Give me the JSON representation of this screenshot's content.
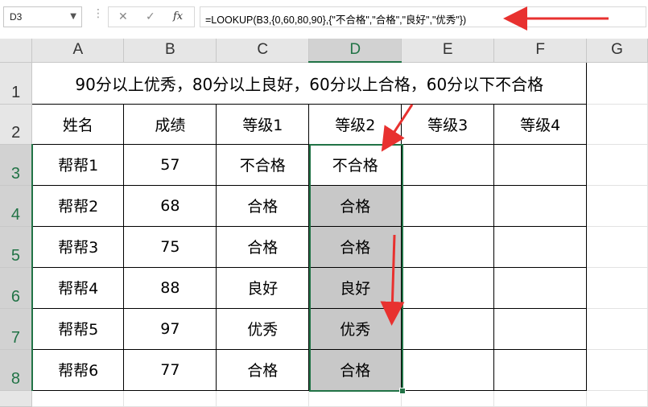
{
  "name_box": "D3",
  "formula": "=LOOKUP(B3,{0,60,80,90},{\"不合格\",\"合格\",\"良好\",\"优秀\"})",
  "formula_buttons": {
    "cancel": "✕",
    "enter": "✓",
    "fx": "fx"
  },
  "columns": [
    "A",
    "B",
    "C",
    "D",
    "E",
    "F",
    "G"
  ],
  "rows": [
    "1",
    "2",
    "3",
    "4",
    "5",
    "6",
    "7",
    "8"
  ],
  "title": "90分以上优秀，80分以上良好，60分以上合格，60分以下不合格",
  "headers": [
    "姓名",
    "成绩",
    "等级1",
    "等级2",
    "等级3",
    "等级4"
  ],
  "data_rows": [
    [
      "帮帮1",
      "57",
      "不合格",
      "不合格",
      "",
      ""
    ],
    [
      "帮帮2",
      "68",
      "合格",
      "合格",
      "",
      ""
    ],
    [
      "帮帮3",
      "75",
      "合格",
      "合格",
      "",
      ""
    ],
    [
      "帮帮4",
      "88",
      "良好",
      "良好",
      "",
      ""
    ],
    [
      "帮帮5",
      "97",
      "优秀",
      "优秀",
      "",
      ""
    ],
    [
      "帮帮6",
      "77",
      "合格",
      "合格",
      "",
      ""
    ]
  ],
  "colors": {
    "accent": "#217346",
    "selected_fill": "#c8c8c8",
    "annotation_arrow": "#e8312f"
  }
}
